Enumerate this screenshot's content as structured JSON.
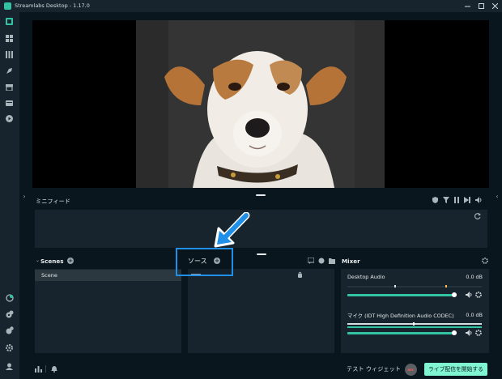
{
  "window": {
    "title": "Streamlabs Desktop - 1.17.0",
    "controls": [
      "minimize-icon",
      "maximize-icon",
      "close-icon"
    ]
  },
  "sidebar": {
    "top_icons": [
      "dashboard-icon",
      "layout-icon",
      "themes-icon",
      "app-store-icon",
      "store-icon",
      "video-icon",
      "highlighter-icon"
    ],
    "bottom_icons": [
      "studio-mode-icon",
      "layout-editor-icon",
      "settings-gear-icon",
      "help-icon",
      "profile-icon"
    ]
  },
  "minifeed": {
    "title": "ミニフィード",
    "toolbar_icons": [
      "shield-icon",
      "filter-icon",
      "pause-icon",
      "skip-icon",
      "volume-icon"
    ]
  },
  "scenes": {
    "title": "Scenes",
    "items": [
      "Scene"
    ]
  },
  "sources": {
    "title": "ソース"
  },
  "mixer": {
    "title": "Mixer",
    "channels": [
      {
        "name": "Desktop Audio",
        "db": "0.0 dB",
        "level": 0.98
      },
      {
        "name": "マイク (IDT High Definition Audio CODEC)",
        "db": "0.0 dB",
        "level": 0.98
      }
    ]
  },
  "footer": {
    "test_widgets": "テスト ウィジェット",
    "rec_label": "REC",
    "go_live": "ライブ配信を開始する"
  },
  "colors": {
    "background": "#09161d",
    "panel": "#17242d",
    "accent": "#31c3a2",
    "go_live": "#80f5d2",
    "highlight": "#1f8fe8"
  }
}
